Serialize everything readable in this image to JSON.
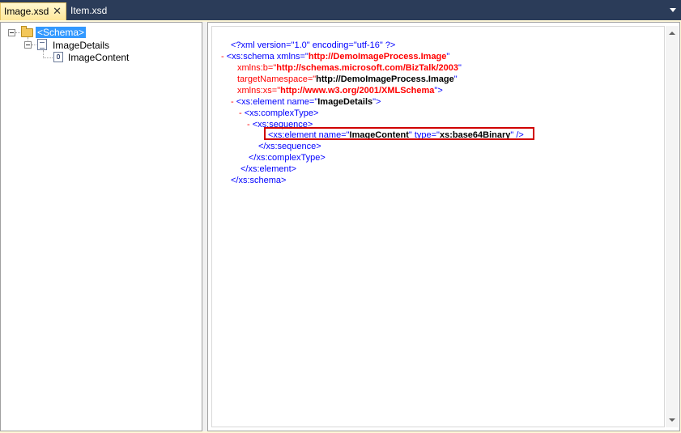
{
  "tabs": [
    {
      "label": "Image.xsd",
      "active": true,
      "close": "✕"
    },
    {
      "label": "Item.xsd",
      "active": false
    }
  ],
  "tree": {
    "root": "<Schema>",
    "record": "ImageDetails",
    "field": "ImageContent"
  },
  "xml": {
    "line1": {
      "a": "<?xml version=\"1.0\" encoding=\"utf-16\" ?>"
    },
    "line2": {
      "marker": "-",
      "tag": "<xs:schema xmlns=\"",
      "val": "http://DemoImageProcess.Image",
      "end": "\""
    },
    "line3": {
      "attr": "xmlns:b=\"",
      "val": "http://schemas.microsoft.com/BizTalk/2003",
      "end": "\""
    },
    "line4": {
      "attr": "targetNamespace=\"",
      "val": "http://DemoImageProcess.Image",
      "end": "\""
    },
    "line5": {
      "attr": "xmlns:xs=\"",
      "val": "http://www.w3.org/2001/XMLSchema",
      "end": "\">"
    },
    "line6": {
      "marker": "-",
      "tag": "<xs:element name=\"",
      "val": "ImageDetails",
      "end": "\">"
    },
    "line7": {
      "marker": "-",
      "tag": "<xs:complexType>"
    },
    "line8": {
      "marker": "-",
      "tag": "<xs:sequence>"
    },
    "line9": {
      "tag": "<xs:element name=\"",
      "val": "ImageContent",
      "mid": "\" type=\"",
      "val2": "xs:base64Binary",
      "end": "\" />"
    },
    "line10": {
      "tag": "</xs:sequence>"
    },
    "line11": {
      "tag": "</xs:complexType>"
    },
    "line12": {
      "tag": "</xs:element>"
    },
    "line13": {
      "tag": "</xs:schema>"
    }
  },
  "colors": {
    "tag": "#0000ff",
    "value": "#ff0000",
    "highlight": "#d00000",
    "tab_active": "#ffe89a",
    "chrome": "#2b3c59"
  }
}
